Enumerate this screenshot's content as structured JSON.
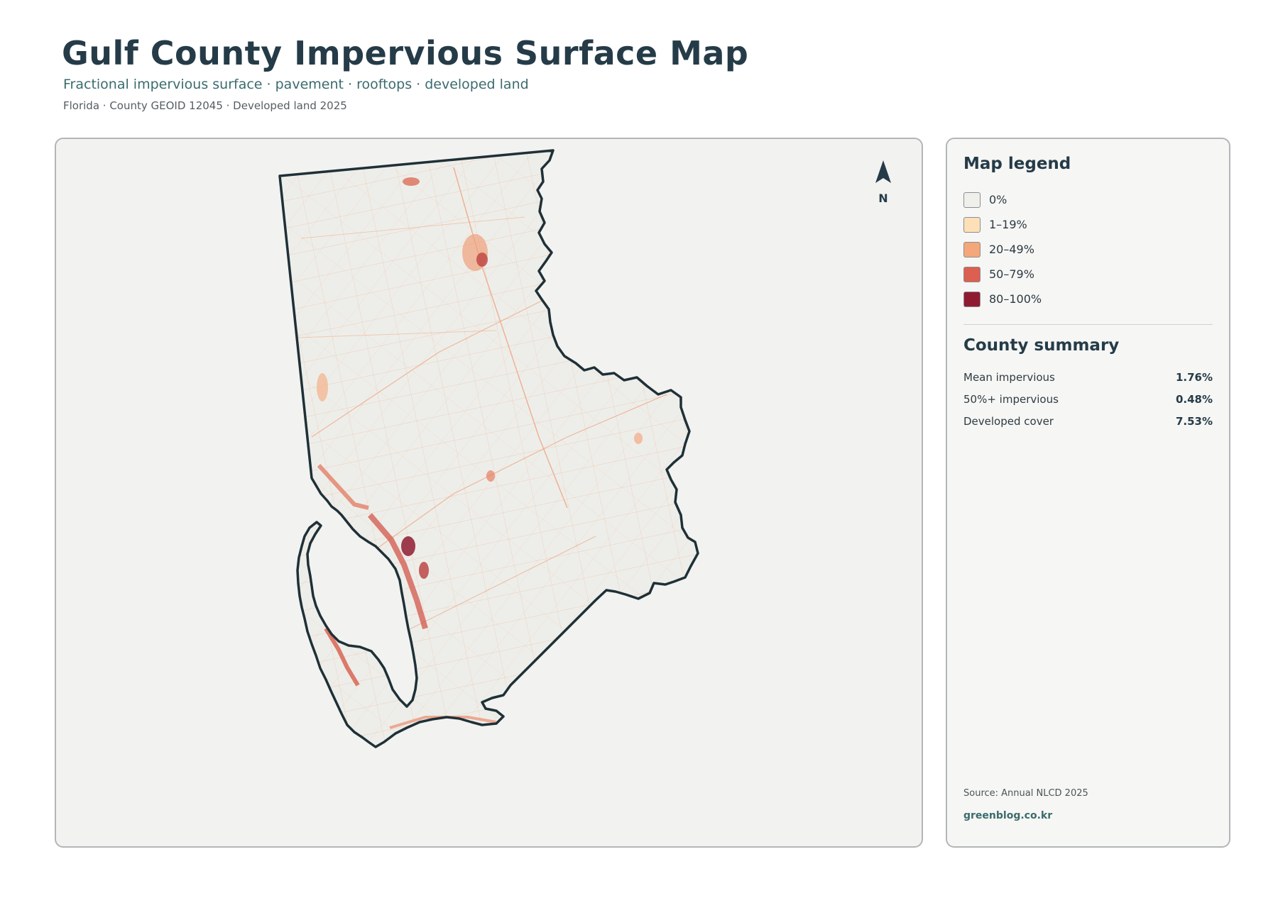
{
  "header": {
    "title": "Gulf County Impervious Surface Map",
    "subtitle": "Fractional impervious surface · pavement · rooftops · developed land",
    "meta": "Florida · County GEOID 12045 · Developed land 2025"
  },
  "map": {
    "north_label": "N",
    "land_color": "#edeeea",
    "outline_color": "#1f3037"
  },
  "legend": {
    "title": "Map legend",
    "items": [
      {
        "label": "0%",
        "color": "#efefec"
      },
      {
        "label": "1–19%",
        "color": "#fde0b8"
      },
      {
        "label": "20–49%",
        "color": "#f4a77a"
      },
      {
        "label": "50–79%",
        "color": "#dc5f4f"
      },
      {
        "label": "80–100%",
        "color": "#8f1b31"
      }
    ]
  },
  "summary": {
    "title": "County summary",
    "rows": [
      {
        "label": "Mean impervious",
        "value": "1.76%"
      },
      {
        "label": "50%+ impervious",
        "value": "0.48%"
      },
      {
        "label": "Developed cover",
        "value": "7.53%"
      }
    ]
  },
  "footer": {
    "source": "Source: Annual NLCD 2025",
    "credit": "greenblog.co.kr"
  }
}
